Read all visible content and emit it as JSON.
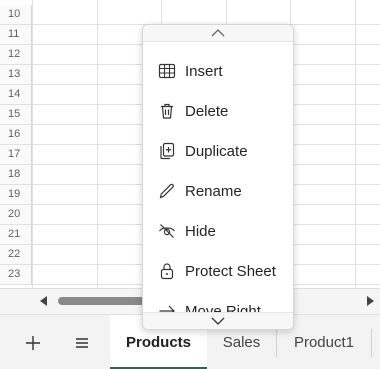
{
  "grid": {
    "row_numbers": [
      "10",
      "11",
      "12",
      "13",
      "14",
      "15",
      "16",
      "17",
      "18",
      "19",
      "20",
      "21",
      "22",
      "23"
    ]
  },
  "context_menu": {
    "items": [
      {
        "label": "Insert",
        "icon": "table-icon"
      },
      {
        "label": "Delete",
        "icon": "trash-icon"
      },
      {
        "label": "Duplicate",
        "icon": "duplicate-icon"
      },
      {
        "label": "Rename",
        "icon": "pencil-icon"
      },
      {
        "label": "Hide",
        "icon": "eye-off-icon"
      },
      {
        "label": "Protect Sheet",
        "icon": "lock-icon"
      },
      {
        "label": "Move Right",
        "icon": "arrow-right-icon"
      }
    ]
  },
  "sheet_bar": {
    "add_icon": "plus-icon",
    "menu_icon": "hamburger-icon",
    "tabs": [
      {
        "label": "Products",
        "active": true
      },
      {
        "label": "Sales",
        "active": false
      },
      {
        "label": "Product1",
        "active": false
      }
    ],
    "active_color": "#1f6b4e"
  }
}
